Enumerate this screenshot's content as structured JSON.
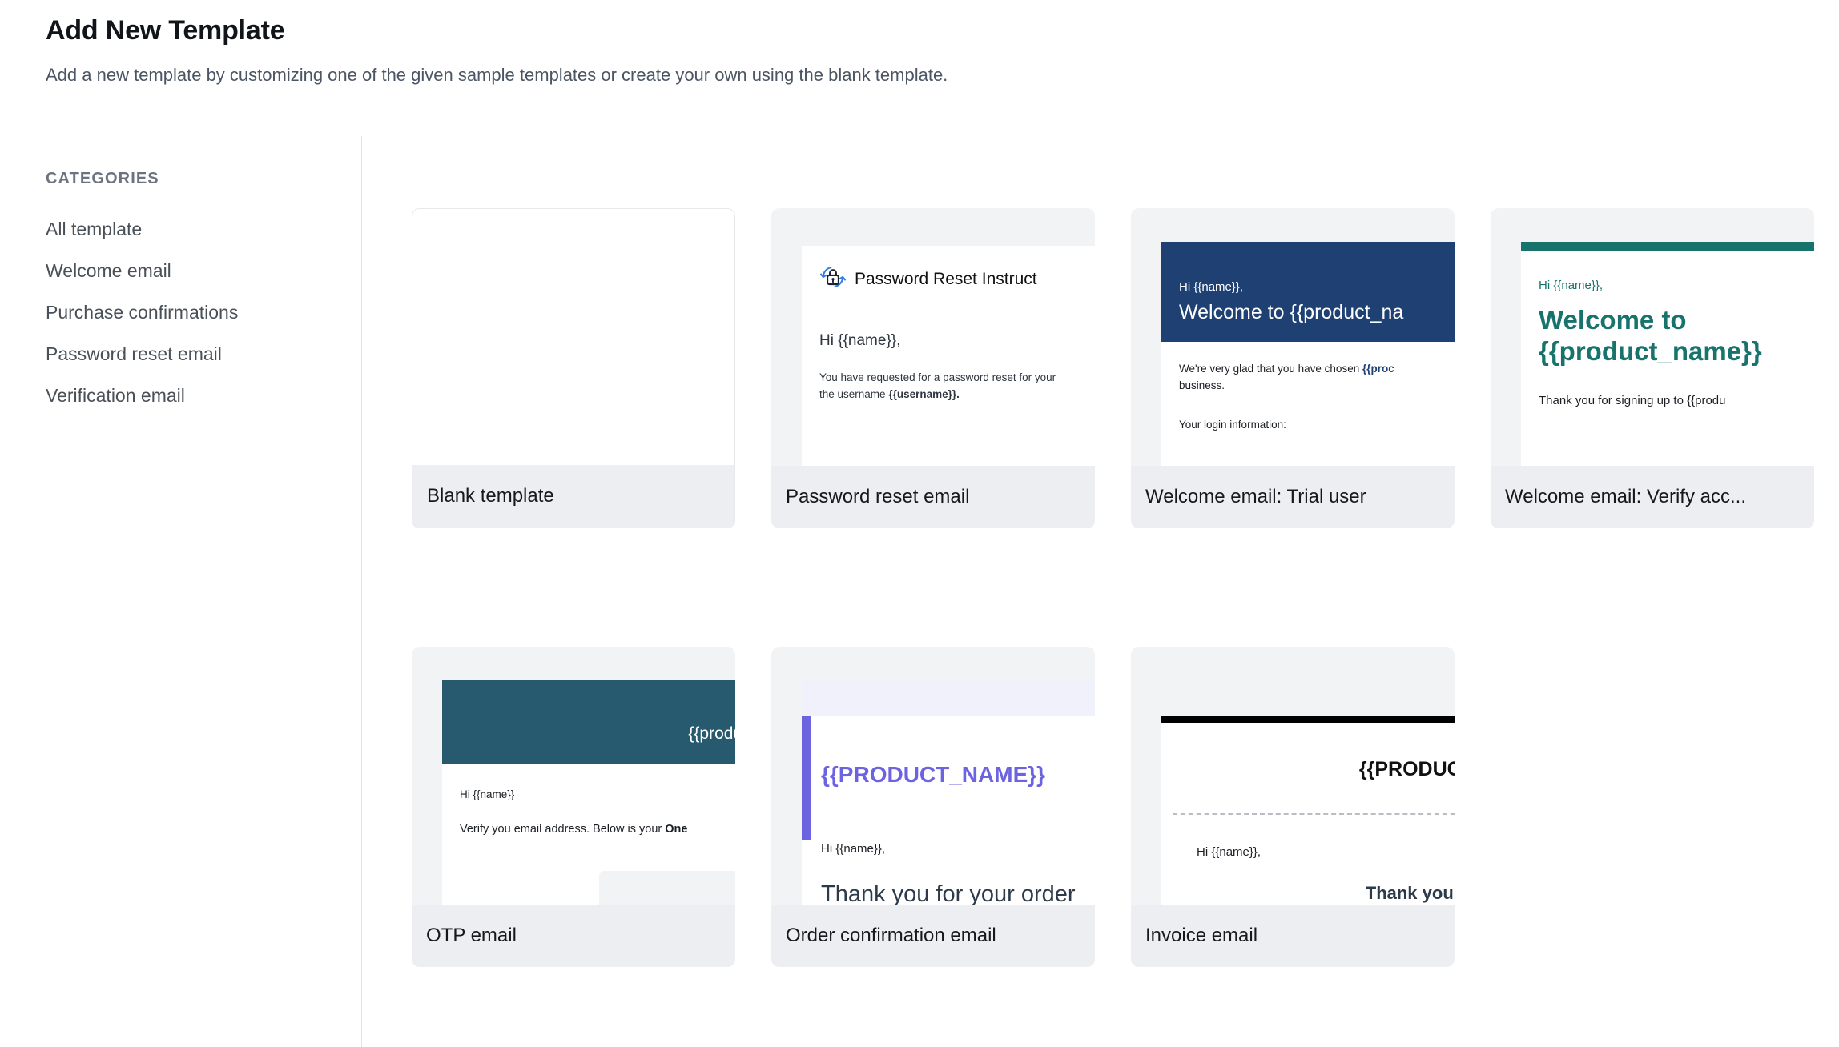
{
  "header": {
    "title": "Add New Template",
    "subtitle": "Add a new template by customizing one of the given sample templates or create your own using the blank template."
  },
  "sidebar": {
    "heading": "CATEGORIES",
    "items": [
      {
        "label": "All template"
      },
      {
        "label": "Welcome email"
      },
      {
        "label": "Purchase confirmations"
      },
      {
        "label": "Password reset email"
      },
      {
        "label": "Verification email"
      }
    ]
  },
  "colors": {
    "navy": "#1e4073",
    "teal_dark": "#17736c",
    "teal_slate": "#275a6e",
    "purple": "#6c63e0",
    "black": "#000000",
    "icon_blue": "#2f7fe8",
    "card_bg": "#f2f3f5",
    "label_bg": "#edeef2"
  },
  "templates": {
    "row1": [
      {
        "name": "blank",
        "label": "Blank template",
        "preview": {}
      },
      {
        "name": "password-reset",
        "label": "Password reset email",
        "preview": {
          "icon": "password-reset-lock-icon",
          "title": "Password Reset Instruct",
          "greeting": "Hi {{name}},",
          "body_a": "You have requested for a password reset for your ",
          "body_b": "the username ",
          "body_b_bold": "{{username}}."
        }
      },
      {
        "name": "welcome-trial",
        "label": "Welcome email: Trial user",
        "preview": {
          "greeting": "Hi {{name}},",
          "headline": "Welcome to {{product_na",
          "body_a": "We're very glad that you have chosen ",
          "body_a_bold": "{{proc",
          "body_b": "business.",
          "body_c": "Your login information:"
        }
      },
      {
        "name": "welcome-verify",
        "label": "Welcome email: Verify acc...",
        "preview": {
          "greeting": "Hi {{name}},",
          "headline_line1": "Welcome to",
          "headline_line2": "{{product_name}}",
          "body": "Thank you for signing up to {{produ"
        }
      }
    ],
    "row2": [
      {
        "name": "otp",
        "label": "OTP email",
        "preview": {
          "brand": "{{product_nam",
          "greeting": "Hi {{name}}",
          "body": "Verify you email address. Below is your ",
          "body_bold": "One"
        }
      },
      {
        "name": "order-confirmation",
        "label": "Order confirmation email",
        "preview": {
          "brand": "{{PRODUCT_NAME}}",
          "greeting": "Hi {{name}},",
          "headline": "Thank you for your order"
        }
      },
      {
        "name": "invoice",
        "label": "Invoice email",
        "preview": {
          "brand": "{{PRODUCT_NA",
          "greeting": "Hi {{name}},",
          "headline": "Thank you for your "
        }
      }
    ]
  }
}
